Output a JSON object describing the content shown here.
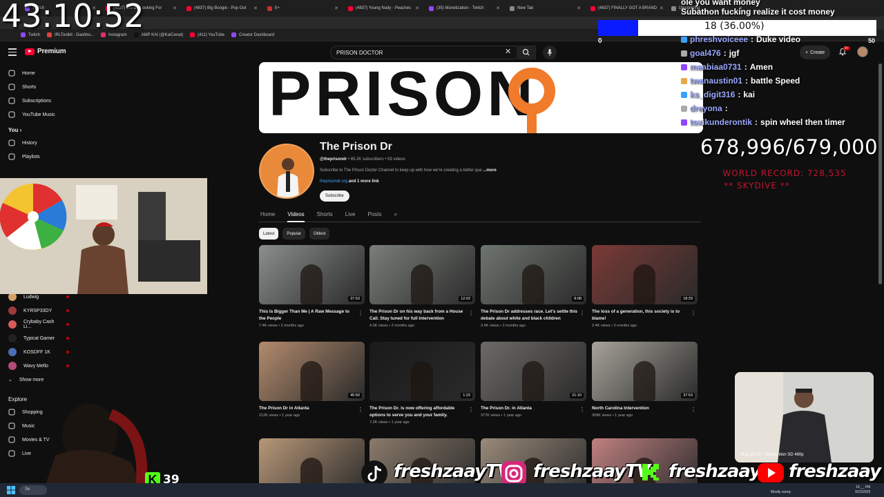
{
  "browser": {
    "tabs": [
      {
        "label": "Twitch",
        "color": "#9146ff"
      },
      {
        "label": "(4837) We Be Looking For",
        "color": "#ff0033"
      },
      {
        "label": "(4837) Big Boogie - Pop Out",
        "color": "#ff0033"
      },
      {
        "label": "5+",
        "color": "#c4302b"
      },
      {
        "label": "(4837) Young Nudy - Peaches",
        "color": "#ff0033"
      },
      {
        "label": "(35) Monetization - Twitch",
        "color": "#9146ff"
      },
      {
        "label": "New Tab",
        "color": "#888888"
      },
      {
        "label": "(4837) FINALLY GOT A BRAND",
        "color": "#ff0033"
      },
      {
        "label": "Disciplining",
        "color": "#888888"
      }
    ],
    "bookmarks": [
      {
        "label": "Twitch",
        "color": "#9146ff"
      },
      {
        "label": "IRLToolkit - Dashbo...",
        "color": "#e04040"
      },
      {
        "label": "Instagram",
        "color": "#e1306c"
      },
      {
        "label": "AMP KAI (@KaiCenat)",
        "color": "#111111"
      },
      {
        "label": "(411) YouTube",
        "color": "#ff0033"
      },
      {
        "label": "Creator Dashboard",
        "color": "#9146ff"
      }
    ]
  },
  "youtube": {
    "logo_text": "Premium",
    "search_value": "PRISON DOCTOR",
    "create_label": "Create",
    "notification_count": "9+",
    "sidebar": {
      "main": [
        {
          "label": "Home",
          "icon": "home-icon"
        },
        {
          "label": "Shorts",
          "icon": "shorts-icon"
        },
        {
          "label": "Subscriptions",
          "icon": "subscriptions-icon"
        },
        {
          "label": "YouTube Music",
          "icon": "music-icon"
        }
      ],
      "you_heading": "You",
      "you_items": [
        {
          "label": "History",
          "icon": "history-icon"
        },
        {
          "label": "Playlists",
          "icon": "playlists-icon"
        }
      ],
      "subscriptions": [
        {
          "label": "Ludwig",
          "color": "#d9a066"
        },
        {
          "label": "KYRSP33DY",
          "color": "#9a3b3b"
        },
        {
          "label": "Crybaby Cash Li...",
          "color": "#d65a5a"
        },
        {
          "label": "Typical Gamer",
          "color": "#222222"
        },
        {
          "label": "KOSDFF 1K",
          "color": "#4a6fb5"
        },
        {
          "label": "Wavy Mello",
          "color": "#b44a7a"
        }
      ],
      "show_more": "Show more",
      "explore_heading": "Explore",
      "explore_items": [
        {
          "label": "Shopping",
          "icon": "shopping-icon"
        },
        {
          "label": "Music",
          "icon": "music-note-icon"
        },
        {
          "label": "Movies & TV",
          "icon": "movies-icon"
        },
        {
          "label": "Live",
          "icon": "live-icon"
        }
      ]
    },
    "channel": {
      "banner_text": "PRISON",
      "name": "The Prison Dr",
      "handle": "@theprisondr",
      "subscribers": "85.2K subscribers",
      "videos_count": "53 videos",
      "description": "Subscribe to The Prison Doctor Channel to keep up with how we're creating a better qua",
      "more": "...more",
      "link": "theprisondr.org",
      "more_links": "and 1 more link",
      "subscribe": "Subscribe",
      "tabs": [
        "Home",
        "Videos",
        "Shorts",
        "Live",
        "Posts"
      ],
      "active_tab": "Videos",
      "chips": [
        "Latest",
        "Popular",
        "Oldest"
      ]
    },
    "videos": [
      {
        "title": "This Is Bigger Than Me | A Raw Message to the People",
        "meta": "7.4K views • 2 months ago",
        "duration": "37:53",
        "color": "#8a8f8c"
      },
      {
        "title": "The Prison Dr on his way back from a House Call. Stay tuned for full intervention",
        "meta": "4.3K views • 2 months ago",
        "duration": "12:02",
        "color": "#7a7f7a"
      },
      {
        "title": "The Prison Dr addresses race. Let's settle this debate about white and black children",
        "meta": "3.4K views • 2 months ago",
        "duration": "8:08",
        "color": "#6f756f"
      },
      {
        "title": "The loss of a generation, this society is to blame!",
        "meta": "3.4K views • 2 months ago",
        "duration": "18:29",
        "color": "#7a3a36"
      },
      {
        "title": "The Prison Dr in Atlanta",
        "meta": "212K views • 1 year ago",
        "duration": "45:50",
        "color": "#b38b6d"
      },
      {
        "title": "The Prison Dr. is now offering affordable options to serve you and your family.",
        "meta": "7.2K views • 1 year ago",
        "duration": "1:23",
        "color": "#1a1a1a"
      },
      {
        "title": "The Prison Dr. in Atlanta",
        "meta": "377K views • 1 year ago",
        "duration": "21:10",
        "color": "#6d6a66"
      },
      {
        "title": "North Carolina Intervention",
        "meta": "309K views • 1 year ago",
        "duration": "37:53",
        "color": "#a7a39a"
      },
      {
        "title": "",
        "meta": "",
        "duration": "",
        "color": "#b89878"
      },
      {
        "title": "",
        "meta": "",
        "duration": "",
        "color": "#8a7a6a"
      },
      {
        "title": "",
        "meta": "",
        "duration": "",
        "color": "#9a8a7a"
      },
      {
        "title": "",
        "meta": "",
        "duration": "",
        "color": "#c08080"
      }
    ]
  },
  "overlay": {
    "timer": "43:10:52",
    "goal": {
      "text": "18 (36.00%)",
      "min": "0",
      "max": "50",
      "progress": 0.36
    },
    "chat": [
      {
        "user": "",
        "msg": "ole you want money"
      },
      {
        "user": "",
        "msg": "Subathon fucking realize it cost money"
      },
      {
        "user": "phreshvoiceee",
        "msg": "Duke video"
      },
      {
        "user": "goal476",
        "msg": "jgf"
      },
      {
        "user": "maabiaa0731",
        "msg": "Amen"
      },
      {
        "user": "twanaustin01",
        "msg": "battle Speed"
      },
      {
        "user": "ks_digit316",
        "msg": "kai"
      },
      {
        "user": "dreyona",
        "msg": ""
      },
      {
        "user": "toxikunderontik",
        "msg": "spin wheel then timer"
      }
    ],
    "counter": "678,996/679,000",
    "world_record": "WORLD RECORD: 728,535",
    "skydive": "** SKYDIVE **",
    "kick_count": "39",
    "socials": [
      {
        "platform": "tiktok",
        "handle": "freshzaayTV"
      },
      {
        "platform": "instagram",
        "handle": "freshzaayTV"
      },
      {
        "platform": "kick",
        "handle": "freshzaay"
      },
      {
        "platform": "youtube",
        "handle": "freshzaay"
      }
    ],
    "pip_label": "Vlog 101 P... Intervention SD 480p"
  },
  "taskbar": {
    "search": "Se",
    "weather": "Mostly sunny",
    "time": "10:__ PM",
    "date": "9/22/2025"
  }
}
